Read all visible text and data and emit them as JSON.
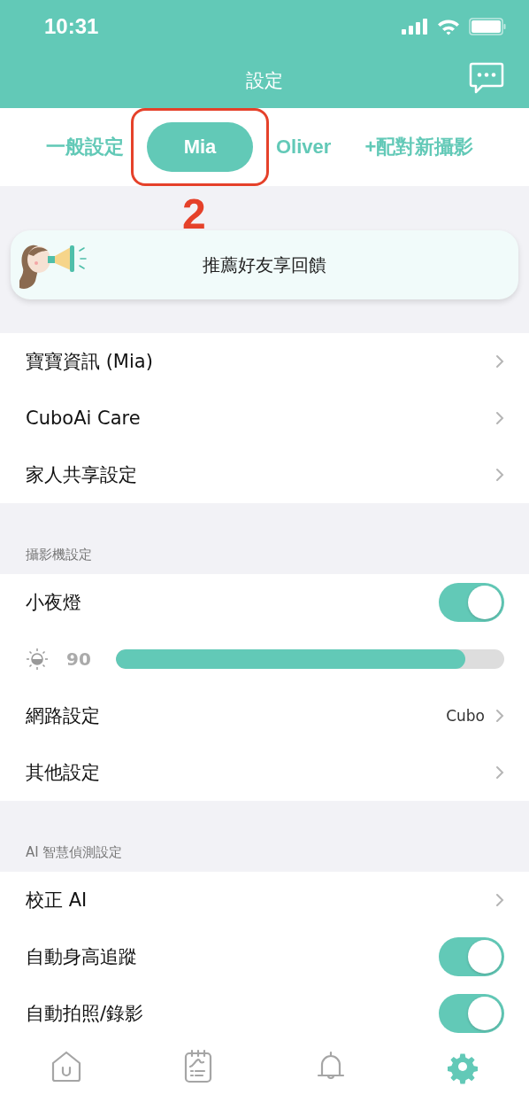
{
  "status_bar": {
    "time": "10:31"
  },
  "header": {
    "title": "設定"
  },
  "tabs": [
    {
      "label": "一般設定",
      "selected": false,
      "annotated": false
    },
    {
      "label": "Mia",
      "selected": true,
      "annotated": true
    },
    {
      "label": "Oliver",
      "selected": false,
      "annotated": false
    },
    {
      "label": "+配對新攝影",
      "selected": false,
      "annotated": false
    }
  ],
  "annotation": {
    "label": "2"
  },
  "banner": {
    "text": "推薦好友享回饋"
  },
  "sections": [
    {
      "rows": [
        {
          "kind": "link",
          "label": "寶寶資訊 (Mia)"
        },
        {
          "kind": "link",
          "label": "CuboAi Care"
        },
        {
          "kind": "link",
          "label": "家人共享設定"
        }
      ]
    },
    {
      "title": "攝影機設定",
      "rows": [
        {
          "kind": "toggle",
          "label": "小夜燈",
          "on": true
        },
        {
          "kind": "slider",
          "reading": "90",
          "level": 0.9
        },
        {
          "kind": "link",
          "label": "網路設定",
          "value": "Cubo"
        },
        {
          "kind": "link",
          "label": "其他設定"
        }
      ]
    },
    {
      "title": "AI 智慧偵測設定",
      "rows": [
        {
          "kind": "link",
          "label": "校正 AI"
        },
        {
          "kind": "toggle",
          "label": "自動身高追蹤",
          "on": true
        },
        {
          "kind": "toggle",
          "label": "自動拍照/錄影",
          "on": true
        }
      ]
    }
  ],
  "tab_bar": [
    {
      "kind": "home",
      "selected": false
    },
    {
      "kind": "journal",
      "selected": false
    },
    {
      "kind": "bell",
      "selected": false
    },
    {
      "kind": "gear",
      "selected": true
    }
  ]
}
